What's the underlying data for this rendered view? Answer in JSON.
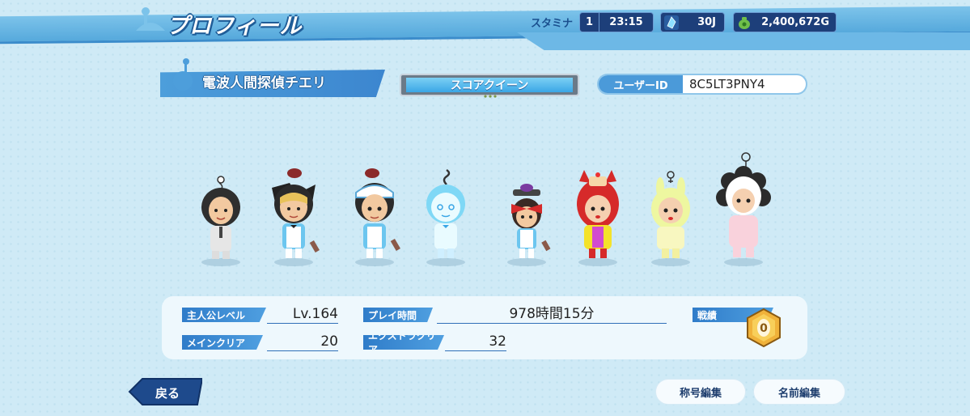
{
  "header": {
    "title": "プロフィール",
    "stamina_label": "スタミナ",
    "stamina_count": "1",
    "stamina_timer": "23:15",
    "gems": "30J",
    "gold": "2,400,672G"
  },
  "profile": {
    "player_name": "電波人間探偵チエリ",
    "title_plate": "スコアクイーン",
    "user_id_label": "ユーザーID",
    "user_id": "8C5LT3PNY4"
  },
  "stats": {
    "hero_level_label": "主人公レベル",
    "hero_level": "Lv.164",
    "play_time_label": "プレイ時間",
    "play_time": "978時間15分",
    "record_label": "戦績",
    "main_clear_label": "メインクリア",
    "main_clear": "20",
    "extra_clear_label": "エクストラクリア",
    "extra_clear": "32",
    "medal_value": "0"
  },
  "buttons": {
    "back": "戻る",
    "edit_title": "称号編集",
    "edit_name": "名前編集"
  },
  "colors": {
    "accent": "#3c86cf",
    "header": "#56a9dc",
    "dark_pill": "#1d3f7a",
    "background": "#cfeaf6"
  }
}
